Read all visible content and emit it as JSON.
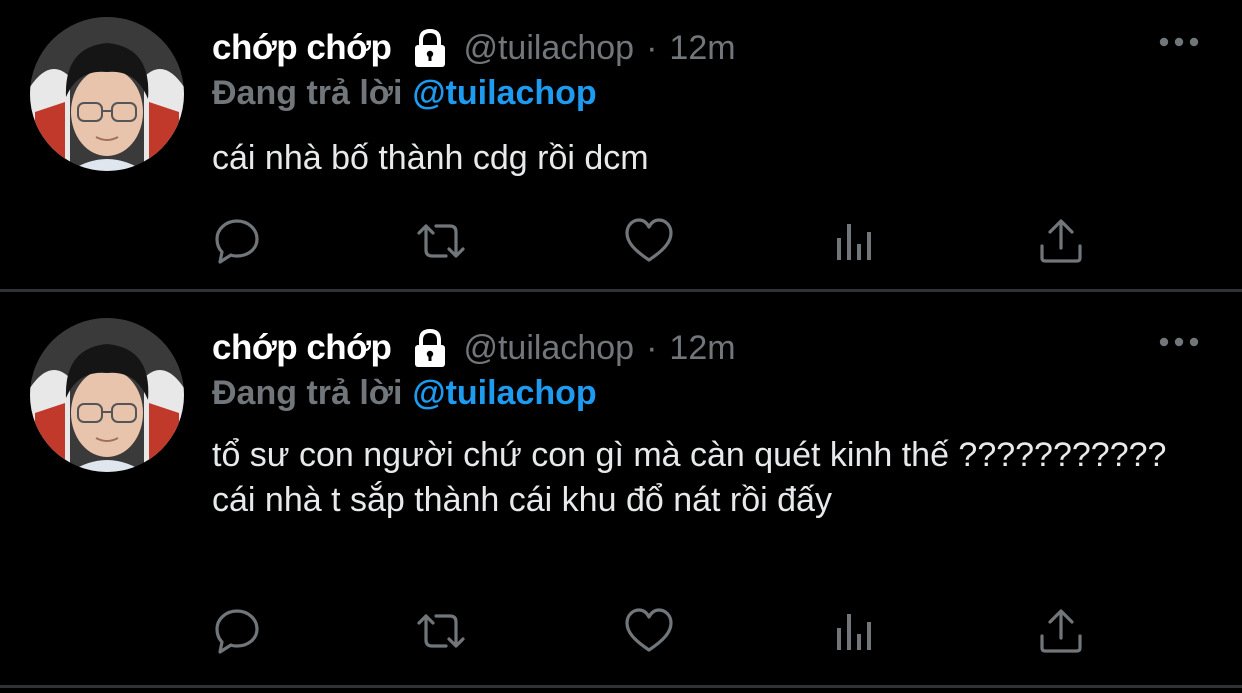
{
  "tweets": [
    {
      "author_name": "chớp chớp",
      "handle": "@tuilachop",
      "separator": "·",
      "time": "12m",
      "replying_label": "Đang trả lời",
      "replying_to": "@tuilachop",
      "text": "cái nhà bố thành cdg rồi dcm",
      "icons": [
        "avatar",
        "lock-icon",
        "more-icon",
        "reply-icon",
        "retweet-icon",
        "like-icon",
        "stats-icon",
        "share-icon"
      ]
    },
    {
      "author_name": "chớp chớp",
      "handle": "@tuilachop",
      "separator": "·",
      "time": "12m",
      "replying_label": "Đang trả lời",
      "replying_to": "@tuilachop",
      "text": "tổ sư con người chứ con gì mà càn quét kinh thế ??????????? cái nhà t sắp thành cái khu đổ nát rồi đấy",
      "icons": [
        "avatar",
        "lock-icon",
        "more-icon",
        "reply-icon",
        "retweet-icon",
        "like-icon",
        "stats-icon",
        "share-icon"
      ]
    }
  ],
  "colors": {
    "background": "#000000",
    "primary_text": "#e7e9ea",
    "secondary_text": "#71767b",
    "accent": "#1d9bf0",
    "divider": "#2f3336"
  }
}
